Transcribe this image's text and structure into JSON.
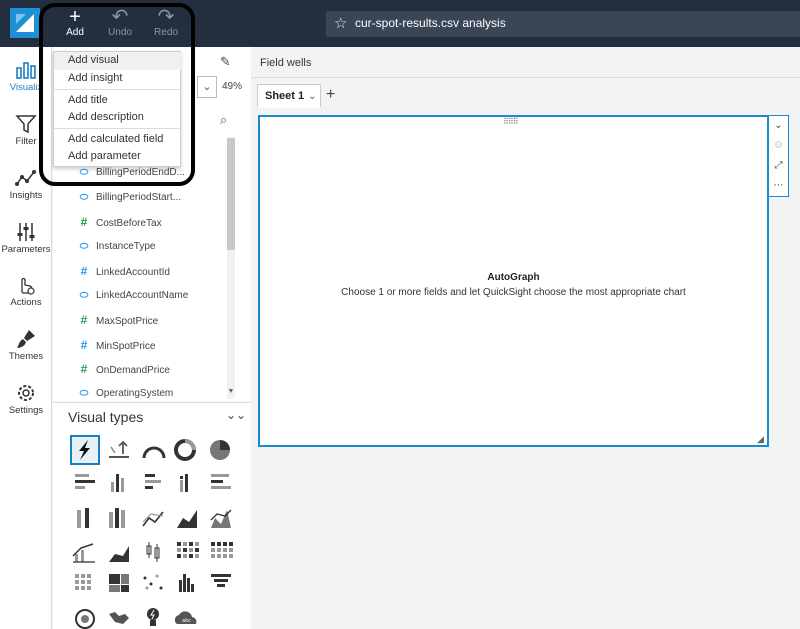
{
  "toolbar": {
    "add_label": "Add",
    "undo_label": "Undo",
    "redo_label": "Redo",
    "analysis_name": "cur-spot-results.csv analysis"
  },
  "rail": [
    {
      "label": "Visualiz",
      "icon": "visualize-icon"
    },
    {
      "label": "Filter",
      "icon": "filter-icon"
    },
    {
      "label": "Insights",
      "icon": "insights-icon"
    },
    {
      "label": "Parameters",
      "icon": "parameters-icon"
    },
    {
      "label": "Actions",
      "icon": "actions-icon"
    },
    {
      "label": "Themes",
      "icon": "themes-icon"
    },
    {
      "label": "Settings",
      "icon": "settings-icon"
    }
  ],
  "add_menu": {
    "items": [
      "Add visual",
      "Add insight",
      "Add title",
      "Add description",
      "Add calculated field",
      "Add parameter"
    ]
  },
  "fields_panel": {
    "zoom": "49%",
    "fields": [
      {
        "name": "BillingPeriodEndD...",
        "type": "dimension"
      },
      {
        "name": "BillingPeriodStart...",
        "type": "dimension"
      },
      {
        "name": "CostBeforeTax",
        "type": "measure"
      },
      {
        "name": "InstanceType",
        "type": "dimension"
      },
      {
        "name": "LinkedAccountId",
        "type": "measure-blue"
      },
      {
        "name": "LinkedAccountName",
        "type": "dimension"
      },
      {
        "name": "MaxSpotPrice",
        "type": "measure"
      },
      {
        "name": "MinSpotPrice",
        "type": "measure-blue"
      },
      {
        "name": "OnDemandPrice",
        "type": "measure"
      },
      {
        "name": "OperatingSystem",
        "type": "dimension"
      }
    ]
  },
  "visual_types": {
    "title": "Visual types"
  },
  "main": {
    "field_wells_label": "Field wells",
    "sheet_tab": "Sheet 1",
    "autograph_title": "AutoGraph",
    "autograph_subtitle": "Choose 1 or more fields and let QuickSight choose the most appropriate chart"
  },
  "colors": {
    "topbar": "#232f3e",
    "accent": "#1a8bd1",
    "measure_green": "#1aa34a"
  }
}
